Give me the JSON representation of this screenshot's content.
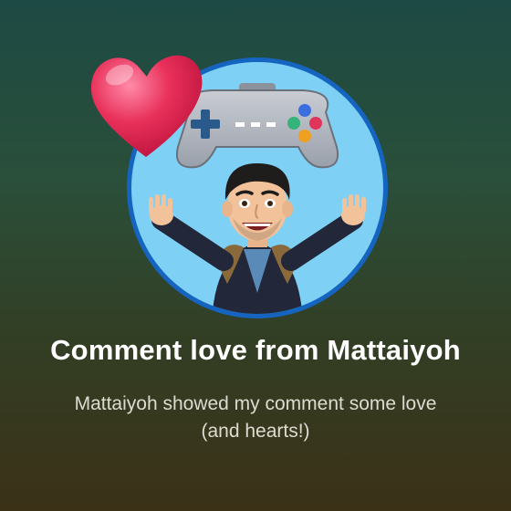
{
  "notification": {
    "title": "Comment love from Mattaiyoh",
    "message": "Mattaiyoh showed my comment some love (and hearts!)"
  },
  "icons": {
    "avatar": "bitmoji-avatar-with-gamepad",
    "heart": "heart-icon",
    "gamepad": "gamepad-icon"
  },
  "colors": {
    "background_top": "#1d4a44",
    "background_bottom": "#3b3117",
    "avatar_ring": "#1a8fe0",
    "avatar_fill": "#7fd0f5",
    "heart": "#e8305a",
    "title_text": "#ffffff",
    "message_text": "#dcdcd2"
  }
}
